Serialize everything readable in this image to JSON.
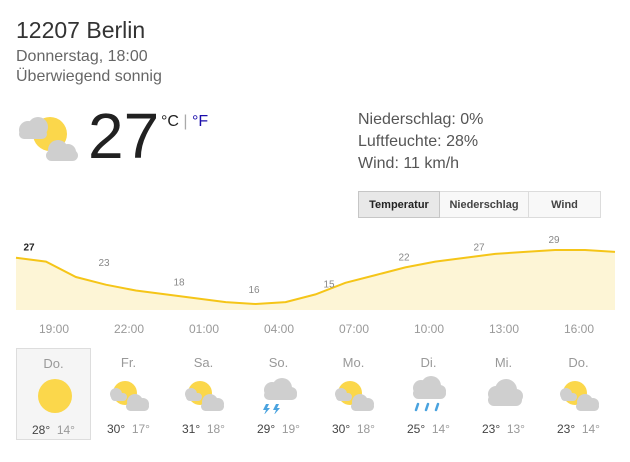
{
  "location": "12207 Berlin",
  "datetime": "Donnerstag, 18:00",
  "condition": "Überwiegend sonnig",
  "current": {
    "temperature": "27",
    "unit_c": "°C",
    "unit_sep": " | ",
    "unit_f": "°F",
    "icon": "sun-cloud-icon"
  },
  "details": {
    "precipitation": "Niederschlag: 0%",
    "humidity": "Luftfeuchte: 28%",
    "wind": "Wind: 11 km/h"
  },
  "tabs": [
    {
      "label": "Temperatur",
      "active": true
    },
    {
      "label": "Niederschlag",
      "active": false
    },
    {
      "label": "Wind",
      "active": false
    }
  ],
  "colors": {
    "chart_line": "#f5c518",
    "chart_fill": "#fdf5d6",
    "sun": "#fbd74b",
    "rain": "#4aa3df"
  },
  "chart_data": {
    "type": "area",
    "x": [
      "19:00",
      "22:00",
      "01:00",
      "04:00",
      "07:00",
      "10:00",
      "13:00",
      "16:00"
    ],
    "labels": [
      27,
      23,
      18,
      16,
      15,
      22,
      27,
      29
    ],
    "series": [
      {
        "values": [
          27,
          26,
          22,
          20,
          18.5,
          17.5,
          16.5,
          15.5,
          15,
          15.5,
          17.5,
          20.5,
          22.5,
          24.5,
          26,
          27,
          28,
          28.5,
          29,
          29,
          28.5
        ]
      }
    ]
  },
  "days": [
    {
      "name": "Do.",
      "high": "28°",
      "low": "14°",
      "icon": "sun-icon",
      "selected": true
    },
    {
      "name": "Fr.",
      "high": "30°",
      "low": "17°",
      "icon": "sun-cloud-icon",
      "selected": false
    },
    {
      "name": "Sa.",
      "high": "31°",
      "low": "18°",
      "icon": "sun-cloud-icon",
      "selected": false
    },
    {
      "name": "So.",
      "high": "29°",
      "low": "19°",
      "icon": "thunderstorm-icon",
      "selected": false
    },
    {
      "name": "Mo.",
      "high": "30°",
      "low": "18°",
      "icon": "sun-cloud-icon",
      "selected": false
    },
    {
      "name": "Di.",
      "high": "25°",
      "low": "14°",
      "icon": "rain-cloud-icon",
      "selected": false
    },
    {
      "name": "Mi.",
      "high": "23°",
      "low": "13°",
      "icon": "cloud-icon",
      "selected": false
    },
    {
      "name": "Do.",
      "high": "23°",
      "low": "14°",
      "icon": "sun-cloud-icon",
      "selected": false
    }
  ]
}
